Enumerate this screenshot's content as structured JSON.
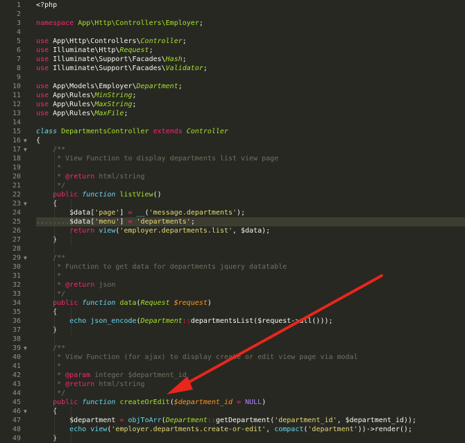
{
  "editor": {
    "lines": [
      {
        "n": "1",
        "fold": false,
        "tokens": [
          [
            "plain",
            "<?php"
          ]
        ]
      },
      {
        "n": "2",
        "fold": false,
        "tokens": []
      },
      {
        "n": "3",
        "fold": false,
        "tokens": [
          [
            "kw",
            "namespace "
          ],
          [
            "class",
            "App\\Http\\Controllers\\Employer"
          ],
          [
            "plain",
            ";"
          ]
        ]
      },
      {
        "n": "4",
        "fold": false,
        "tokens": []
      },
      {
        "n": "5",
        "fold": false,
        "tokens": [
          [
            "kw",
            "use "
          ],
          [
            "plain",
            "App\\Http\\Controllers\\"
          ],
          [
            "italic",
            "Controller"
          ],
          [
            "plain",
            ";"
          ]
        ]
      },
      {
        "n": "6",
        "fold": false,
        "tokens": [
          [
            "kw",
            "use "
          ],
          [
            "plain",
            "Illuminate\\Http\\"
          ],
          [
            "italic",
            "Request"
          ],
          [
            "plain",
            ";"
          ]
        ]
      },
      {
        "n": "7",
        "fold": false,
        "tokens": [
          [
            "kw",
            "use "
          ],
          [
            "plain",
            "Illuminate\\Support\\Facades\\"
          ],
          [
            "italic",
            "Hash"
          ],
          [
            "plain",
            ";"
          ]
        ]
      },
      {
        "n": "8",
        "fold": false,
        "tokens": [
          [
            "kw",
            "use "
          ],
          [
            "plain",
            "Illuminate\\Support\\Facades\\"
          ],
          [
            "italic",
            "Validator"
          ],
          [
            "plain",
            ";"
          ]
        ]
      },
      {
        "n": "9",
        "fold": false,
        "tokens": []
      },
      {
        "n": "10",
        "fold": false,
        "tokens": [
          [
            "kw",
            "use "
          ],
          [
            "plain",
            "App\\Models\\Employer\\"
          ],
          [
            "italic",
            "Department"
          ],
          [
            "plain",
            ";"
          ]
        ]
      },
      {
        "n": "11",
        "fold": false,
        "tokens": [
          [
            "kw",
            "use "
          ],
          [
            "plain",
            "App\\Rules\\"
          ],
          [
            "italic",
            "MinString"
          ],
          [
            "plain",
            ";"
          ]
        ]
      },
      {
        "n": "12",
        "fold": false,
        "tokens": [
          [
            "kw",
            "use "
          ],
          [
            "plain",
            "App\\Rules\\"
          ],
          [
            "italic",
            "MaxString"
          ],
          [
            "plain",
            ";"
          ]
        ]
      },
      {
        "n": "13",
        "fold": false,
        "tokens": [
          [
            "kw",
            "use "
          ],
          [
            "plain",
            "App\\Rules\\"
          ],
          [
            "italic",
            "MaxFile"
          ],
          [
            "plain",
            ";"
          ]
        ]
      },
      {
        "n": "14",
        "fold": false,
        "tokens": []
      },
      {
        "n": "15",
        "fold": false,
        "tokens": [
          [
            "storage",
            "class "
          ],
          [
            "class",
            "DepartmentsController "
          ],
          [
            "kw",
            "extends "
          ],
          [
            "italic",
            "Controller"
          ]
        ]
      },
      {
        "n": "16",
        "fold": true,
        "tokens": [
          [
            "plain",
            "{"
          ]
        ]
      },
      {
        "n": "17",
        "fold": true,
        "tokens": [
          [
            "plain",
            "    "
          ],
          [
            "com",
            "/**"
          ]
        ]
      },
      {
        "n": "18",
        "fold": false,
        "tokens": [
          [
            "plain",
            "    "
          ],
          [
            "com",
            " * View Function to display departments list view page"
          ]
        ]
      },
      {
        "n": "19",
        "fold": false,
        "tokens": [
          [
            "plain",
            "    "
          ],
          [
            "com",
            " *"
          ]
        ]
      },
      {
        "n": "20",
        "fold": false,
        "tokens": [
          [
            "plain",
            "    "
          ],
          [
            "com",
            " * "
          ],
          [
            "tag",
            "@return"
          ],
          [
            "com",
            " html/string"
          ]
        ]
      },
      {
        "n": "21",
        "fold": false,
        "tokens": [
          [
            "plain",
            "    "
          ],
          [
            "com",
            " */"
          ]
        ]
      },
      {
        "n": "22",
        "fold": false,
        "tokens": [
          [
            "plain",
            "    "
          ],
          [
            "kw",
            "public "
          ],
          [
            "storage",
            "function "
          ],
          [
            "func",
            "listView"
          ],
          [
            "plain",
            "()"
          ]
        ]
      },
      {
        "n": "23",
        "fold": true,
        "tokens": [
          [
            "plain",
            "    {"
          ]
        ]
      },
      {
        "n": "24",
        "fold": false,
        "tokens": [
          [
            "plain",
            "        $data["
          ],
          [
            "str",
            "'page'"
          ],
          [
            "plain",
            "] "
          ],
          [
            "op",
            "="
          ],
          [
            "plain",
            " "
          ],
          [
            "sup",
            "__"
          ],
          [
            "plain",
            "("
          ],
          [
            "str",
            "'message.departments'"
          ],
          [
            "plain",
            ");"
          ]
        ]
      },
      {
        "n": "25",
        "fold": false,
        "current": true,
        "tokens": [
          [
            "dim",
            "........"
          ],
          [
            "plain",
            "$data["
          ],
          [
            "str",
            "'menu'"
          ],
          [
            "plain",
            "] "
          ],
          [
            "op",
            "="
          ],
          [
            "plain",
            " "
          ],
          [
            "str",
            "'departments'"
          ],
          [
            "plain",
            ";"
          ]
        ]
      },
      {
        "n": "26",
        "fold": false,
        "tokens": [
          [
            "plain",
            "        "
          ],
          [
            "kw",
            "return "
          ],
          [
            "sup",
            "view"
          ],
          [
            "plain",
            "("
          ],
          [
            "str",
            "'employer.departments.list'"
          ],
          [
            "plain",
            ", $data);"
          ]
        ]
      },
      {
        "n": "27",
        "fold": false,
        "tokens": [
          [
            "plain",
            "    }"
          ]
        ]
      },
      {
        "n": "28",
        "fold": false,
        "tokens": []
      },
      {
        "n": "29",
        "fold": true,
        "tokens": [
          [
            "plain",
            "    "
          ],
          [
            "com",
            "/**"
          ]
        ]
      },
      {
        "n": "30",
        "fold": false,
        "tokens": [
          [
            "plain",
            "    "
          ],
          [
            "com",
            " * Function to get data for departments jquery datatable"
          ]
        ]
      },
      {
        "n": "31",
        "fold": false,
        "tokens": [
          [
            "plain",
            "    "
          ],
          [
            "com",
            " *"
          ]
        ]
      },
      {
        "n": "32",
        "fold": false,
        "tokens": [
          [
            "plain",
            "    "
          ],
          [
            "com",
            " * "
          ],
          [
            "tag",
            "@return"
          ],
          [
            "com",
            " json"
          ]
        ]
      },
      {
        "n": "33",
        "fold": false,
        "tokens": [
          [
            "plain",
            "    "
          ],
          [
            "com",
            " */"
          ]
        ]
      },
      {
        "n": "34",
        "fold": false,
        "tokens": [
          [
            "plain",
            "    "
          ],
          [
            "kw",
            "public "
          ],
          [
            "storage",
            "function "
          ],
          [
            "func",
            "data"
          ],
          [
            "plain",
            "("
          ],
          [
            "italic",
            "Request "
          ],
          [
            "param",
            "$request"
          ],
          [
            "plain",
            ")"
          ]
        ]
      },
      {
        "n": "35",
        "fold": false,
        "tokens": [
          [
            "plain",
            "    {"
          ]
        ]
      },
      {
        "n": "36",
        "fold": false,
        "tokens": [
          [
            "plain",
            "        "
          ],
          [
            "sup",
            "echo "
          ],
          [
            "sup",
            "json_encode"
          ],
          [
            "plain",
            "("
          ],
          [
            "italic",
            "Department"
          ],
          [
            "op",
            "::"
          ],
          [
            "plain",
            "departmentsList($request->all()));"
          ]
        ]
      },
      {
        "n": "37",
        "fold": false,
        "tokens": [
          [
            "plain",
            "    }"
          ]
        ]
      },
      {
        "n": "38",
        "fold": false,
        "tokens": []
      },
      {
        "n": "39",
        "fold": true,
        "tokens": [
          [
            "plain",
            "    "
          ],
          [
            "com",
            "/**"
          ]
        ]
      },
      {
        "n": "40",
        "fold": false,
        "tokens": [
          [
            "plain",
            "    "
          ],
          [
            "com",
            " * View Function (for ajax) to display create or edit view page via modal"
          ]
        ]
      },
      {
        "n": "41",
        "fold": false,
        "tokens": [
          [
            "plain",
            "    "
          ],
          [
            "com",
            " *"
          ]
        ]
      },
      {
        "n": "42",
        "fold": false,
        "tokens": [
          [
            "plain",
            "    "
          ],
          [
            "com",
            " * "
          ],
          [
            "tag",
            "@param"
          ],
          [
            "com",
            " integer $department_id"
          ]
        ]
      },
      {
        "n": "43",
        "fold": false,
        "tokens": [
          [
            "plain",
            "    "
          ],
          [
            "com",
            " * "
          ],
          [
            "tag",
            "@return"
          ],
          [
            "com",
            " html/string"
          ]
        ]
      },
      {
        "n": "44",
        "fold": false,
        "tokens": [
          [
            "plain",
            "    "
          ],
          [
            "com",
            " */"
          ]
        ]
      },
      {
        "n": "45",
        "fold": false,
        "tokens": [
          [
            "plain",
            "    "
          ],
          [
            "kw",
            "public "
          ],
          [
            "storage",
            "function "
          ],
          [
            "func",
            "createOrEdit"
          ],
          [
            "plain",
            "("
          ],
          [
            "param",
            "$department_id"
          ],
          [
            "plain",
            " "
          ],
          [
            "op",
            "="
          ],
          [
            "plain",
            " "
          ],
          [
            "const",
            "NULL"
          ],
          [
            "plain",
            ")"
          ]
        ]
      },
      {
        "n": "46",
        "fold": true,
        "tokens": [
          [
            "plain",
            "    {"
          ]
        ]
      },
      {
        "n": "47",
        "fold": false,
        "tokens": [
          [
            "plain",
            "        $department "
          ],
          [
            "op",
            "="
          ],
          [
            "plain",
            " "
          ],
          [
            "sup",
            "objToArr"
          ],
          [
            "plain",
            "("
          ],
          [
            "italic",
            "Department"
          ],
          [
            "op",
            "::"
          ],
          [
            "plain",
            "getDepartment("
          ],
          [
            "str",
            "'department_id'"
          ],
          [
            "plain",
            ", $department_id));"
          ]
        ]
      },
      {
        "n": "48",
        "fold": false,
        "tokens": [
          [
            "plain",
            "        "
          ],
          [
            "sup",
            "echo "
          ],
          [
            "sup",
            "view"
          ],
          [
            "plain",
            "("
          ],
          [
            "str",
            "'employer.departments.create-or-edit'"
          ],
          [
            "plain",
            ", "
          ],
          [
            "sup",
            "compact"
          ],
          [
            "plain",
            "("
          ],
          [
            "str",
            "'department'"
          ],
          [
            "plain",
            "))->render();"
          ]
        ]
      },
      {
        "n": "49",
        "fold": false,
        "tokens": [
          [
            "plain",
            "    }"
          ]
        ]
      }
    ]
  },
  "colors": {
    "background": "#272822",
    "arrow": "#e8261c"
  }
}
